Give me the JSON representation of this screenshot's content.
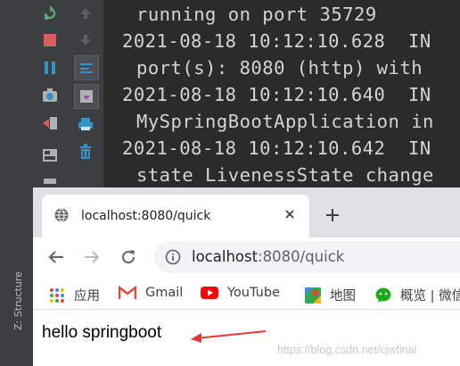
{
  "ide": {
    "structure_label": "Z: Structure",
    "console_lines": [
      "running on port 35729",
      "2021-08-18 10:12:10.628  IN",
      "port(s): 8080 (http) with",
      "2021-08-18 10:12:10.640  IN",
      "MySpringBootApplication in",
      "2021-08-18 10:12:10.642  IN",
      "state LivenessState change"
    ]
  },
  "browser": {
    "tab_title": "localhost:8080/quick",
    "url_host": "localhost",
    "url_rest": ":8080/quick",
    "bookmarks": [
      {
        "label": "应用",
        "icon": "apps-grid-icon"
      },
      {
        "label": "Gmail",
        "icon": "gmail-icon"
      },
      {
        "label": "YouTube",
        "icon": "youtube-icon"
      },
      {
        "label": "地图",
        "icon": "maps-icon"
      },
      {
        "label": "概览 | 微信",
        "icon": "wechat-icon"
      }
    ],
    "page_text": "hello springboot",
    "watermark": "https://blog.csdn.net/cjwfinal"
  },
  "colors": {
    "console_bg": "#2b2b2b",
    "arrow_red": "#e53935"
  }
}
